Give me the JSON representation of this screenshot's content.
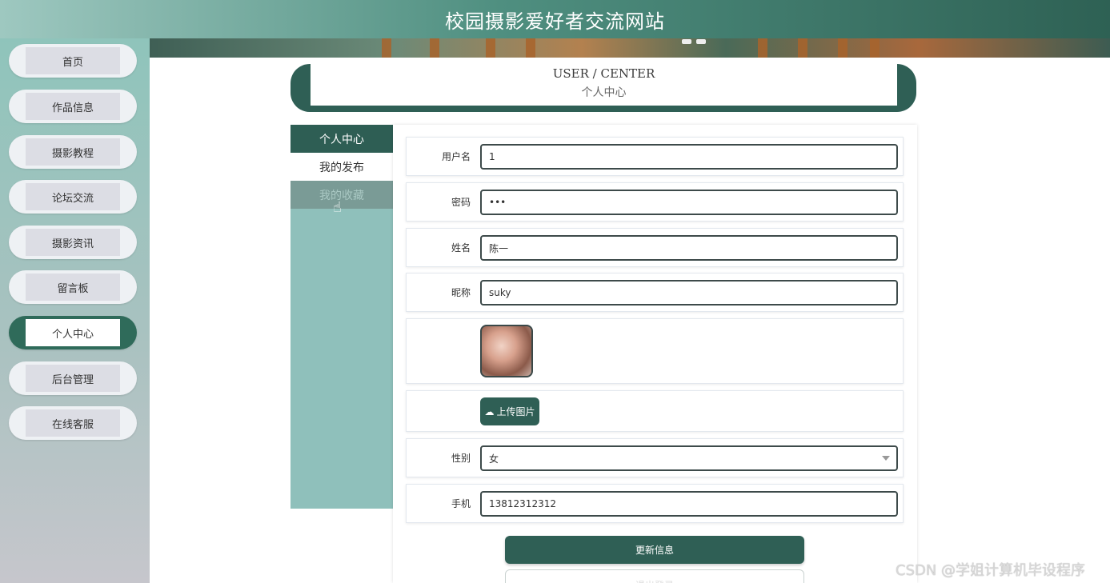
{
  "header": {
    "title": "校园摄影爱好者交流网站"
  },
  "sidebar": {
    "items": [
      {
        "label": "首页",
        "active": false
      },
      {
        "label": "作品信息",
        "active": false
      },
      {
        "label": "摄影教程",
        "active": false
      },
      {
        "label": "论坛交流",
        "active": false
      },
      {
        "label": "摄影资讯",
        "active": false
      },
      {
        "label": "留言板",
        "active": false
      },
      {
        "label": "个人中心",
        "active": true
      },
      {
        "label": "后台管理",
        "active": false
      },
      {
        "label": "在线客服",
        "active": false
      }
    ]
  },
  "user_center": {
    "title_en": "USER / CENTER",
    "title_cn": "个人中心"
  },
  "left_menu": {
    "items": [
      {
        "label": "个人中心",
        "state": "active"
      },
      {
        "label": "我的发布",
        "state": "normal"
      },
      {
        "label": "我的收藏",
        "state": "hover"
      }
    ]
  },
  "form": {
    "username": {
      "label": "用户名",
      "value": "1"
    },
    "password": {
      "label": "密码",
      "value": "•••"
    },
    "name": {
      "label": "姓名",
      "value": "陈一"
    },
    "nickname": {
      "label": "昵称",
      "value": "suky"
    },
    "upload": {
      "label": "上传图片",
      "icon": "cloud-upload-icon"
    },
    "gender": {
      "label": "性别",
      "value": "女"
    },
    "phone": {
      "label": "手机",
      "value": "13812312312"
    }
  },
  "actions": {
    "update_label": "更新信息",
    "logout_label": "退出登录"
  },
  "watermark": "CSDN @学姐计算机毕设程序",
  "colors": {
    "primary": "#2f5f55",
    "sidebar_active": "#2f6b5a",
    "menu_bg": "#8fc0bb"
  }
}
